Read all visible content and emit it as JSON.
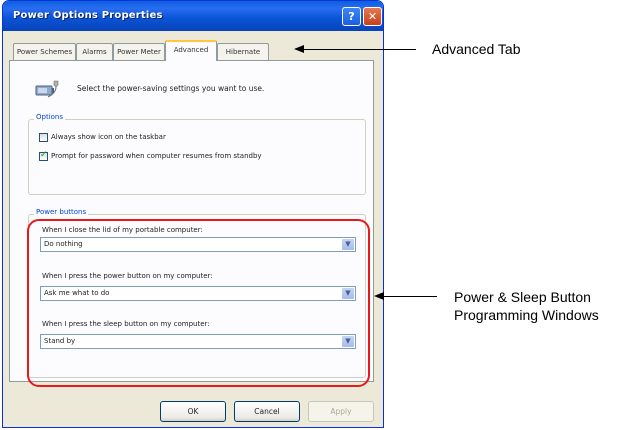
{
  "window": {
    "title": "Power Options Properties"
  },
  "titlebar": {
    "help_glyph": "?",
    "close_glyph": "✕"
  },
  "tabs": [
    {
      "label": "Power Schemes"
    },
    {
      "label": "Alarms"
    },
    {
      "label": "Power Meter"
    },
    {
      "label": "Advanced"
    },
    {
      "label": "Hibernate"
    }
  ],
  "intro_text": "Select the power-saving settings you want to use.",
  "options": {
    "group_label": "Options",
    "checkboxes": [
      {
        "label": "Always show icon on the taskbar",
        "checked": false
      },
      {
        "label": "Prompt for password when computer resumes from standby",
        "checked": true
      }
    ]
  },
  "power_buttons": {
    "group_label": "Power buttons",
    "fields": [
      {
        "label": "When I close the lid of my portable computer:",
        "value": "Do nothing"
      },
      {
        "label": "When I press the power button on my computer:",
        "value": "Ask me what to do"
      },
      {
        "label": "When I press the sleep button on my computer:",
        "value": "Stand by"
      }
    ]
  },
  "buttons": {
    "ok": "OK",
    "cancel": "Cancel",
    "apply": "Apply"
  },
  "annotations": {
    "advanced_tab": "Advanced Tab",
    "power_sleep_line1": "Power  & Sleep Button",
    "power_sleep_line2": "Programming Windows"
  },
  "colors": {
    "highlight": "#e61a1a",
    "titlebar": "#0b55d8",
    "tab_accent": "#ffc73c"
  }
}
